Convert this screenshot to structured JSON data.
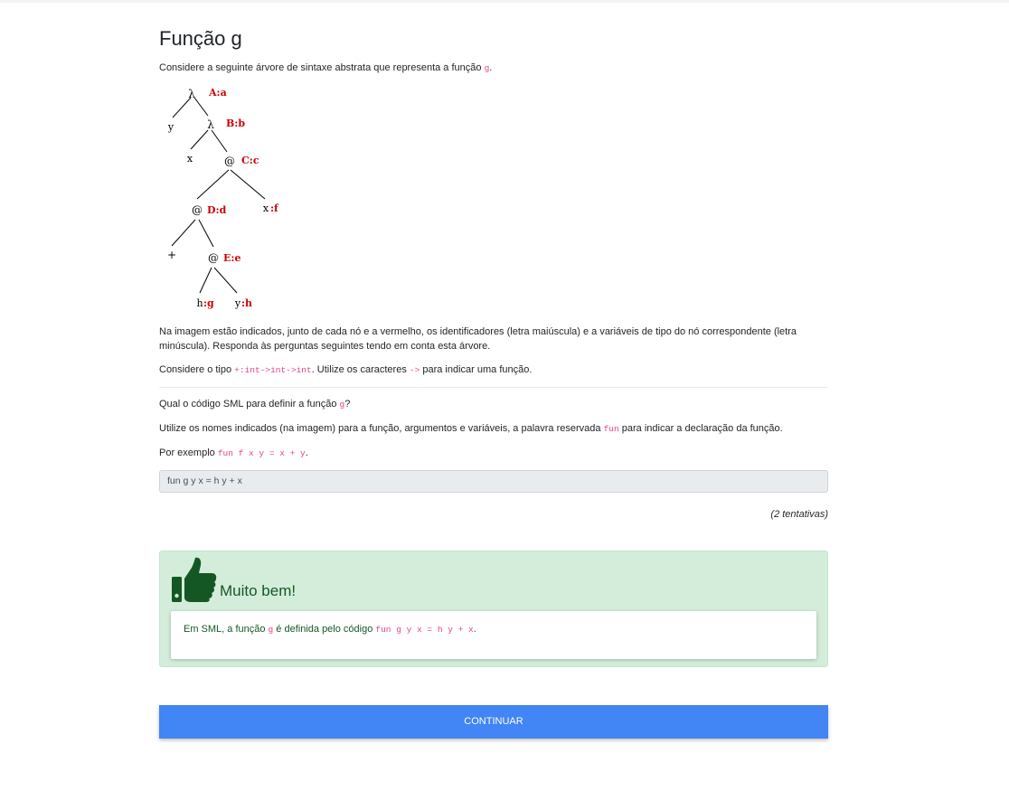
{
  "page": {
    "title": "Função g",
    "intro_prefix": "Considere a seguinte árvore de sintaxe abstrata que representa a função ",
    "intro_code": "g",
    "intro_suffix": ".",
    "explanation": "Na imagem estão indicados, junto de cada nó e a vermelho, os identificadores (letra maiúscula) e a variáveis de tipo do nó correspondente (letra minúscula). Responda às perguntas seguintes tendo em conta esta árvore.",
    "type_prefix": "Considere o tipo ",
    "type_code": "+:int->int->int",
    "type_mid": ". Utilize os caracteres ",
    "type_code2": "->",
    "type_suffix": " para indicar uma função."
  },
  "tree": {
    "nodes": {
      "lambda1": "λ",
      "A": "A:a",
      "y_left": "y",
      "lambda2": "λ",
      "B": "B:b",
      "x_left": "x",
      "app1": "@",
      "C": "C:c",
      "app2": "@",
      "D": "D:d",
      "x_right": "x",
      "f": ":f",
      "plus": "+",
      "app3": "@",
      "E": "E:e",
      "h": "h",
      "g": ":g",
      "y_bottom": "y",
      "hh": ":h"
    },
    "colors": {
      "label": "#cc0000",
      "node": "#000000"
    }
  },
  "question": {
    "q_prefix": "Qual o código SML para definir a função ",
    "q_code": "g",
    "q_suffix": "?",
    "hint_prefix": "Utilize os nomes indicados (na imagem) para a função, argumentos e variáveis, a palavra reservada ",
    "hint_code": "fun",
    "hint_suffix": " para indicar a declaração da função.",
    "example_prefix": "Por exemplo ",
    "example_code": "fun f x y = x + y",
    "example_suffix": ".",
    "answer_value": "fun g y x = h y + x",
    "attempts": "(2 tentativas)"
  },
  "feedback": {
    "icon": "thumbs-up-icon",
    "title": "Muito bem!",
    "text_prefix": "Em SML, a função ",
    "text_code1": "g",
    "text_mid": " é definida pelo código ",
    "text_code2": "fun g y x = h y + x",
    "text_suffix": ".",
    "color": "#155724",
    "background": "#d4edda"
  },
  "actions": {
    "continue_label": "CONTINUAR",
    "continue_color": "#4285f4"
  }
}
